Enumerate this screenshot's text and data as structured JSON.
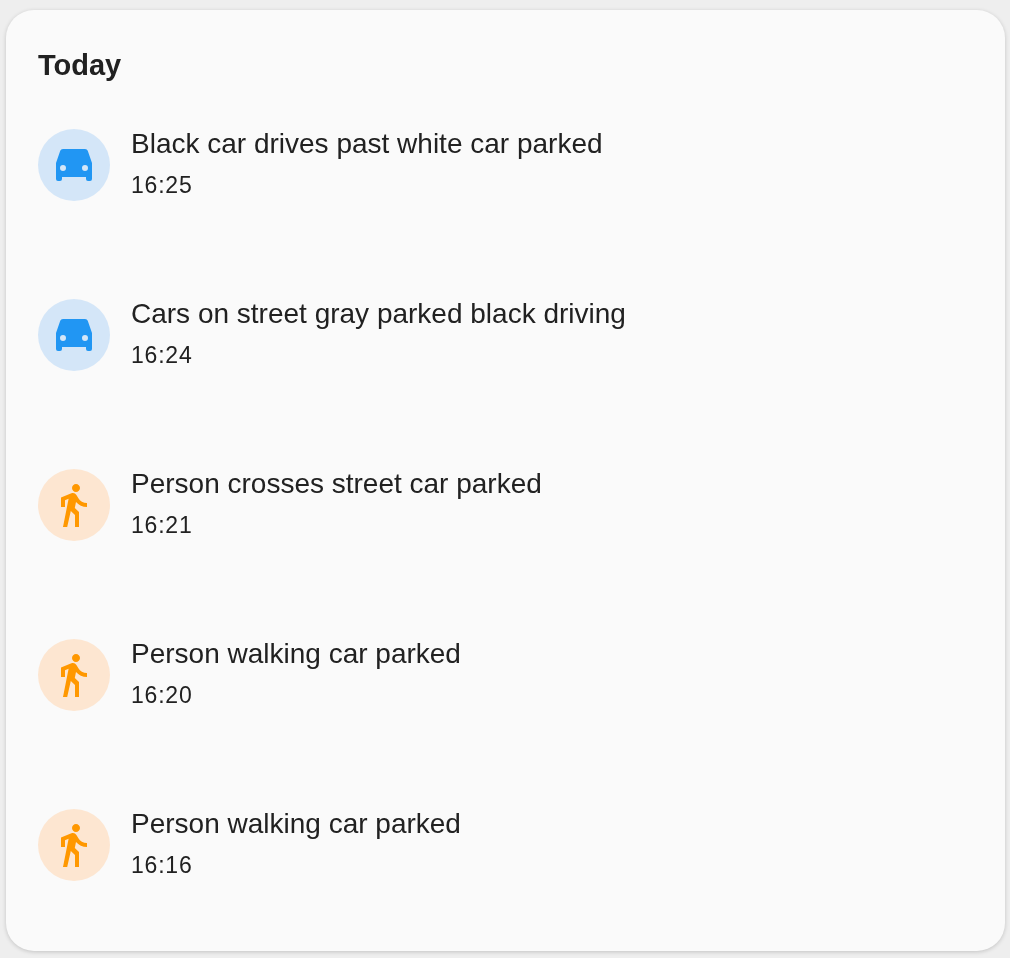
{
  "card": {
    "title": "Today",
    "events": [
      {
        "kind": "car",
        "title": "Black car drives past white car parked",
        "time": "16:25"
      },
      {
        "kind": "car",
        "title": "Cars on street gray parked black driving",
        "time": "16:24"
      },
      {
        "kind": "person",
        "title": "Person crosses street car parked",
        "time": "16:21"
      },
      {
        "kind": "person",
        "title": "Person walking car parked",
        "time": "16:20"
      },
      {
        "kind": "person",
        "title": "Person walking car parked",
        "time": "16:16"
      }
    ]
  }
}
